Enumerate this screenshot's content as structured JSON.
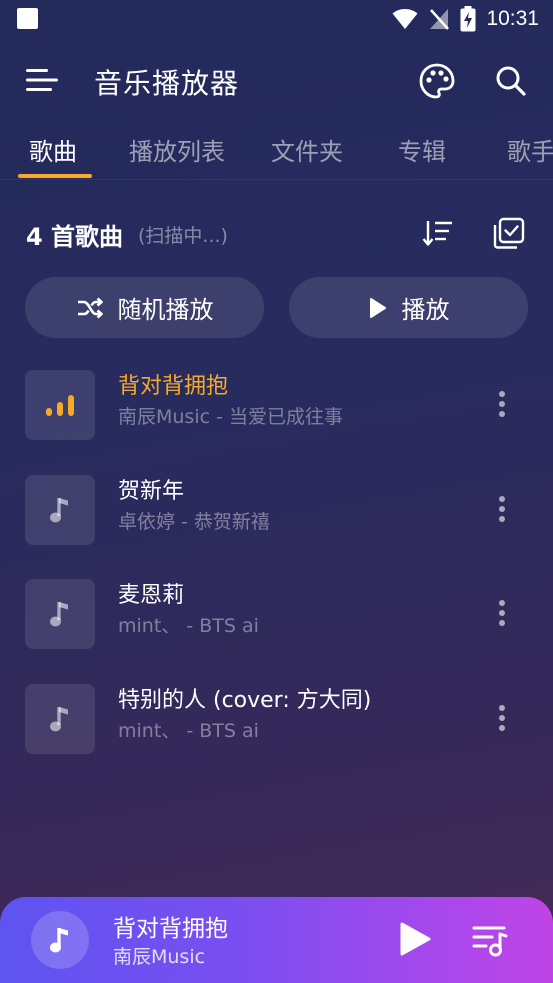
{
  "status_bar": {
    "time": "10:31",
    "icons": [
      "app-notification-square-icon",
      "wifi-icon",
      "no-signal-icon",
      "battery-charging-icon"
    ]
  },
  "app_bar": {
    "title": "音乐播放器",
    "icons": [
      "menu-icon",
      "palette-icon",
      "search-icon"
    ]
  },
  "tabs": [
    {
      "label": "歌曲",
      "active": true
    },
    {
      "label": "播放列表",
      "active": false
    },
    {
      "label": "文件夹",
      "active": false
    },
    {
      "label": "专辑",
      "active": false
    },
    {
      "label": "歌手",
      "active": false
    }
  ],
  "list_header": {
    "count_label": "4 首歌曲",
    "scanning_label": "(扫描中...)",
    "icons": [
      "sort-icon",
      "multi-select-icon"
    ]
  },
  "actions": {
    "shuffle_label": "随机播放",
    "play_label": "播放"
  },
  "songs": [
    {
      "title": "背对背拥抱",
      "subtitle": "南辰Music - 当爱已成往事",
      "playing": true,
      "thumb_icon": "equalizer-icon"
    },
    {
      "title": "贺新年",
      "subtitle": "卓依婷 - 恭贺新禧",
      "playing": false,
      "thumb_icon": "music-note-icon"
    },
    {
      "title": "麦恩莉",
      "subtitle": "mint、 - BTS ai",
      "playing": false,
      "thumb_icon": "music-note-icon"
    },
    {
      "title": "特别的人 (cover: 方大同)",
      "subtitle": "mint、 - BTS ai",
      "playing": false,
      "thumb_icon": "music-note-icon"
    }
  ],
  "mini_player": {
    "title": "背对背拥抱",
    "artist": "南辰Music",
    "icons": [
      "music-note-icon",
      "play-icon",
      "queue-icon"
    ]
  },
  "colors": {
    "accent": "#f7a928",
    "background_top": "#232a5a",
    "background_bottom": "#462a55",
    "player_start": "#5d54f0",
    "player_end": "#c044e6"
  }
}
